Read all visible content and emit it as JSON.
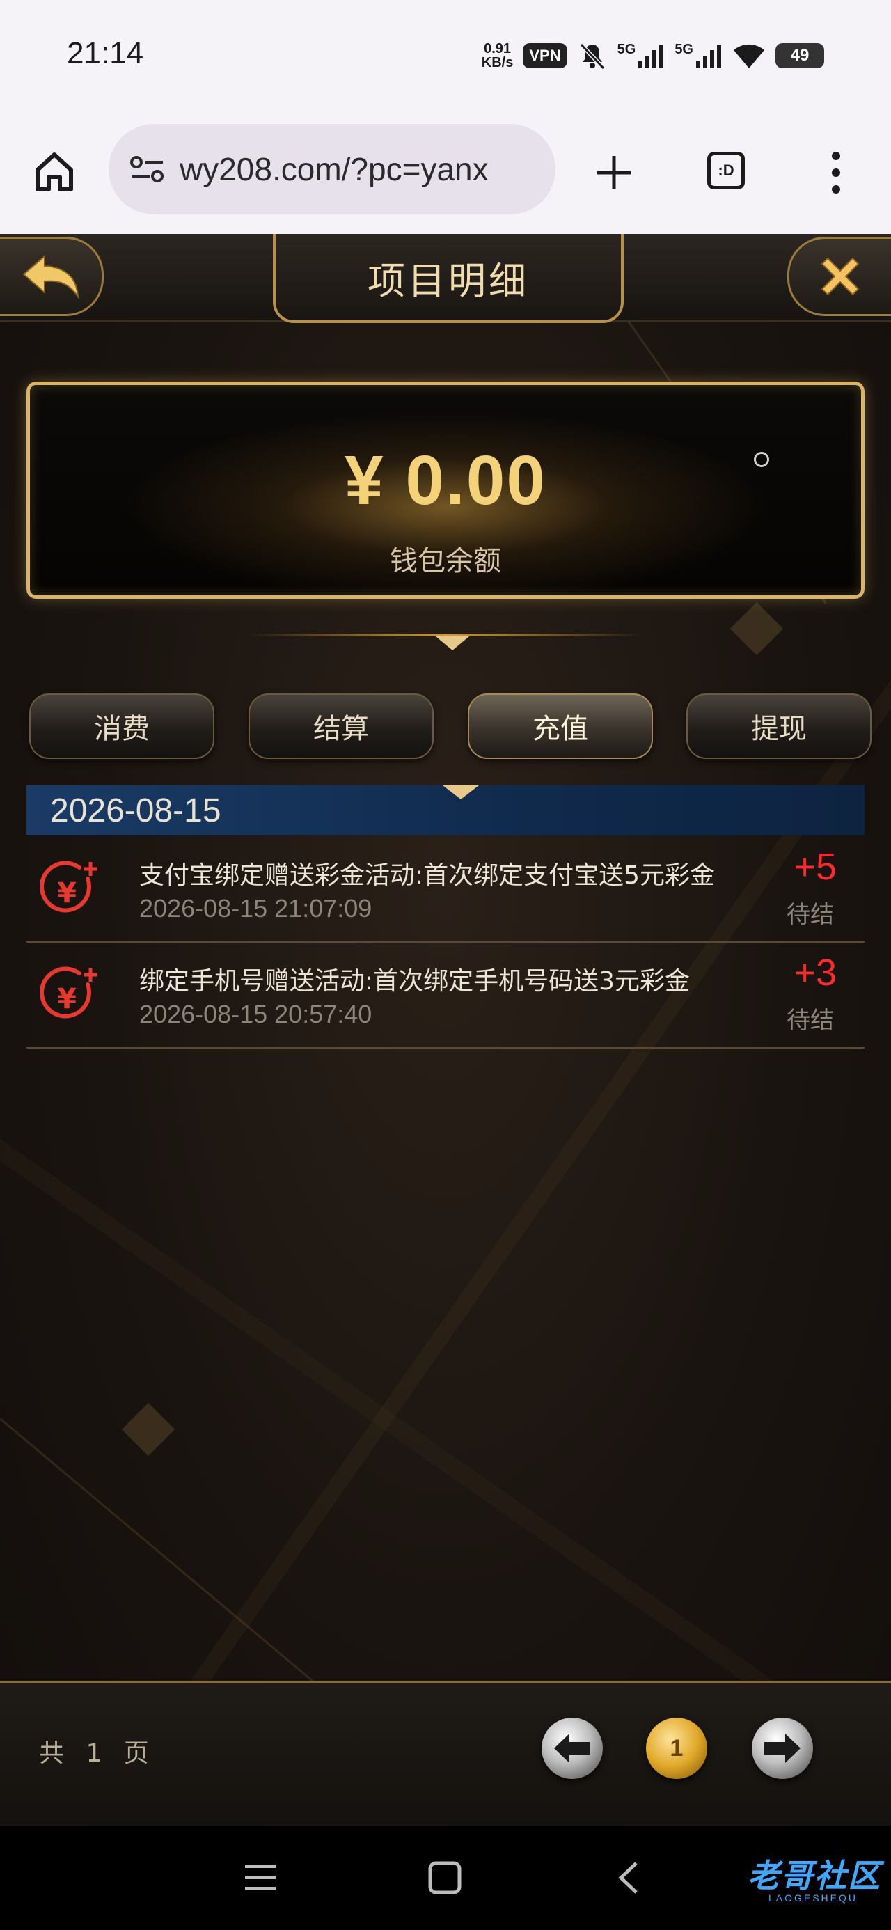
{
  "status_bar": {
    "time": "21:14",
    "net_speed_value": "0.91",
    "net_speed_unit": "KB/s",
    "vpn_label": "VPN",
    "signal1_label": "5G",
    "signal2_label": "5G",
    "battery": "49"
  },
  "browser": {
    "url": "wy208.com/?pc=yanx",
    "tabs_label": ":D"
  },
  "header": {
    "title": "项目明细"
  },
  "wallet": {
    "amount": "¥ 0.00",
    "label": "钱包余额"
  },
  "tabs": [
    {
      "label": "消费"
    },
    {
      "label": "结算"
    },
    {
      "label": "充值",
      "active": true
    },
    {
      "label": "提现"
    }
  ],
  "records_date": "2026-08-15",
  "records": [
    {
      "title": "支付宝绑定赠送彩金活动:首次绑定支付宝送5元彩金",
      "time": "2026-08-15 21:07:09",
      "amount": "+5",
      "status": "待结"
    },
    {
      "title": "绑定手机号赠送活动:首次绑定手机号码送3元彩金",
      "time": "2026-08-15 20:57:40",
      "amount": "+3",
      "status": "待结"
    }
  ],
  "pager": {
    "total_text": "共 1 页",
    "current_page": "1"
  },
  "watermark": {
    "text": "老哥社区",
    "sub": "LAOGESHEQU"
  },
  "colors": {
    "accent_gold": "#d9b466",
    "amount_red": "#ff2b2b",
    "date_bar_blue": "#1a3b66"
  }
}
